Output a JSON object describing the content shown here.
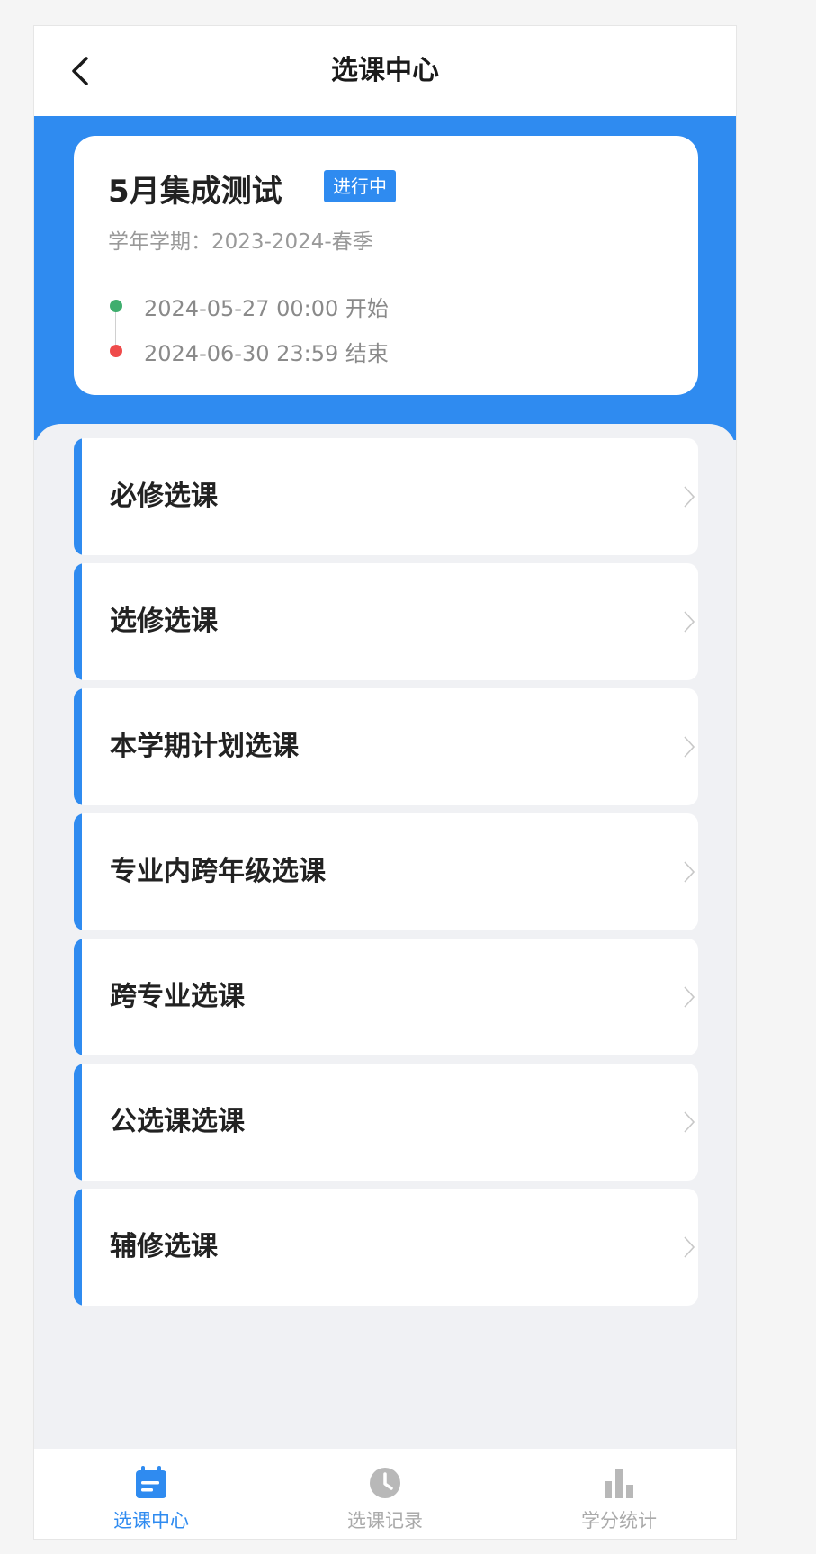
{
  "header": {
    "title": "选课中心"
  },
  "info_card": {
    "title": "5月集成测试",
    "status": "进行中",
    "semester": "学年学期：2023-2024-春季",
    "start_time": "2024-05-27 00:00 开始",
    "end_time": "2024-06-30 23:59 结束"
  },
  "menu": {
    "items": [
      {
        "label": "必修选课"
      },
      {
        "label": "选修选课"
      },
      {
        "label": "本学期计划选课"
      },
      {
        "label": "专业内跨年级选课"
      },
      {
        "label": "跨专业选课"
      },
      {
        "label": "公选课选课"
      },
      {
        "label": "辅修选课"
      }
    ]
  },
  "tabbar": {
    "tabs": [
      {
        "label": "选课中心",
        "icon": "calendar-icon",
        "active": true
      },
      {
        "label": "选课记录",
        "icon": "clock-icon",
        "active": false
      },
      {
        "label": "学分统计",
        "icon": "bar-chart-icon",
        "active": false
      }
    ]
  },
  "colors": {
    "primary": "#2f8bf0",
    "start_dot": "#3fae6e",
    "end_dot": "#ef4b4b"
  }
}
